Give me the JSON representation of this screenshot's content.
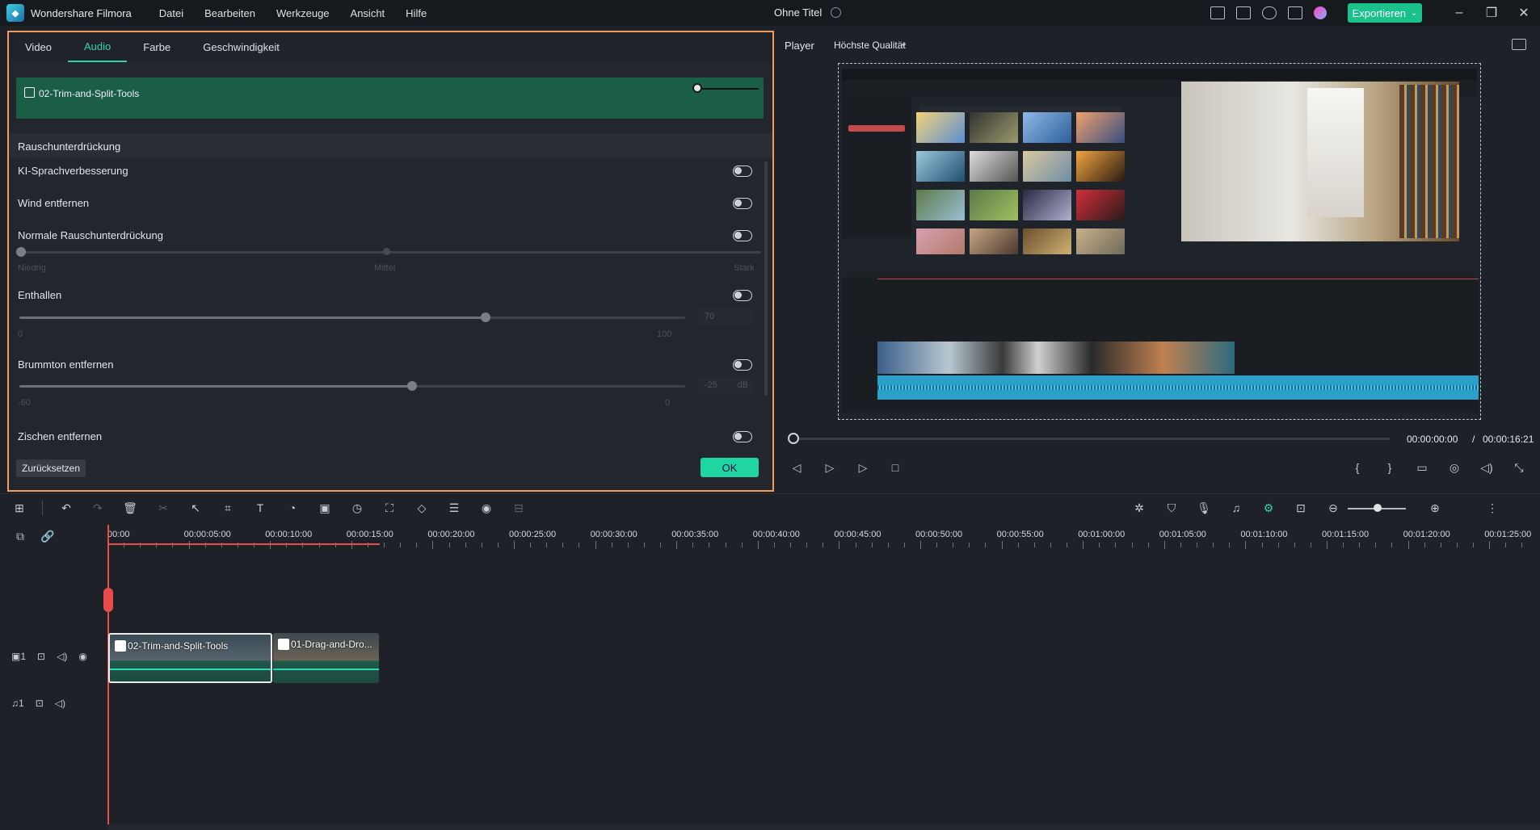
{
  "app": {
    "name": "Wondershare Filmora",
    "menu": [
      "Datei",
      "Bearbeiten",
      "Werkzeuge",
      "Ansicht",
      "Hilfe"
    ],
    "doc_title": "Ohne Titel",
    "export_label": "Exportieren",
    "accent": "#18c28a"
  },
  "panel": {
    "tabs": [
      "Video",
      "Audio",
      "Farbe",
      "Geschwindigkeit"
    ],
    "active_tab": "Audio",
    "clip_name": "02-Trim-and-Split-Tools",
    "section_title": "Rauschunterdrückung",
    "options": {
      "ai_speech": "KI-Sprachverbesserung",
      "wind": "Wind entfernen",
      "normal_noise": "Normale Rauschunterdrückung",
      "dereverb": "Enthallen",
      "hum": "Brummton entfernen",
      "hiss": "Zischen entfernen"
    },
    "noise_levels": [
      "Niedrig",
      "Mittel",
      "Stark"
    ],
    "dereverb_value": "70",
    "dereverb_min": "0",
    "dereverb_max": "100",
    "hum_value": "-25",
    "hum_unit": "dB",
    "hum_min": "-60",
    "hum_max": "0",
    "reset_label": "Zurücksetzen",
    "ok_label": "OK"
  },
  "player": {
    "label": "Player",
    "quality": "Höchste Qualität",
    "current_time": "00:00:00:00",
    "separator": "/",
    "total_time": "00:00:16:21"
  },
  "timeline": {
    "ruler": [
      "00:00",
      "00:00:05:00",
      "00:00:10:00",
      "00:00:15:00",
      "00:00:20:00",
      "00:00:25:00",
      "00:00:30:00",
      "00:00:35:00",
      "00:00:40:00",
      "00:00:45:00",
      "00:00:50:00",
      "00:00:55:00",
      "00:01:00:00",
      "00:01:05:00",
      "00:01:10:00",
      "00:01:15:00",
      "00:01:20:00",
      "00:01:25:00"
    ],
    "clips": [
      "02-Trim-and-Split-Tools",
      "01-Drag-and-Dro..."
    ],
    "video_track_num": "1",
    "audio_track_num": "1"
  }
}
